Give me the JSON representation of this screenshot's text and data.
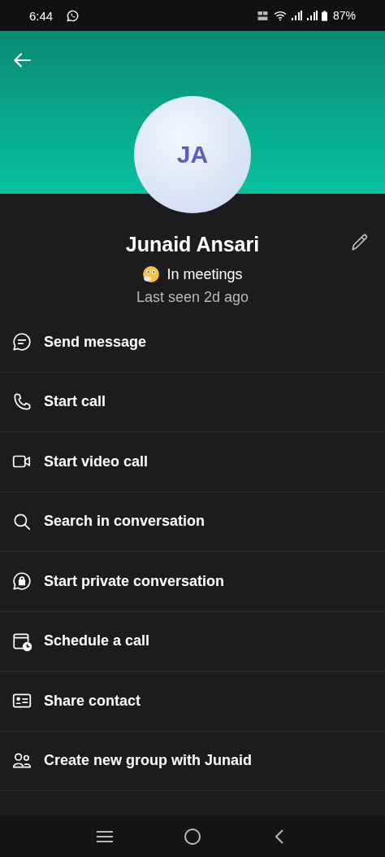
{
  "status_bar": {
    "time": "6:44",
    "battery": "87%"
  },
  "profile": {
    "initials": "JA",
    "name": "Junaid Ansari",
    "status": "In meetings",
    "last_seen": "Last seen 2d ago"
  },
  "actions": [
    {
      "kind": "message",
      "label": "Send message"
    },
    {
      "kind": "call",
      "label": "Start call"
    },
    {
      "kind": "video",
      "label": "Start video call"
    },
    {
      "kind": "search",
      "label": "Search in conversation"
    },
    {
      "kind": "private",
      "label": "Start private conversation"
    },
    {
      "kind": "schedule",
      "label": "Schedule a call"
    },
    {
      "kind": "contact",
      "label": "Share contact"
    },
    {
      "kind": "group",
      "label": "Create new group with Junaid"
    }
  ]
}
